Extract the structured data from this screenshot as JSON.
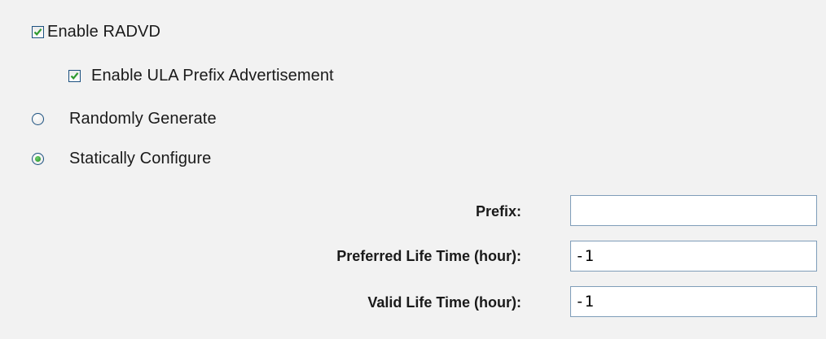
{
  "options": {
    "enable_radvd": {
      "label": "Enable RADVD",
      "checked": true
    },
    "enable_ula": {
      "label": "Enable ULA Prefix Advertisement",
      "checked": true
    },
    "randomly_generate": {
      "label": "Randomly Generate",
      "selected": false
    },
    "statically_configure": {
      "label": "Statically Configure",
      "selected": true
    }
  },
  "fields": {
    "prefix": {
      "label": "Prefix:",
      "value": ""
    },
    "preferred_life_time": {
      "label": "Preferred Life Time (hour):",
      "value": "-1"
    },
    "valid_life_time": {
      "label": "Valid Life Time (hour):",
      "value": "-1"
    }
  },
  "colors": {
    "background": "#f2f2f2",
    "check_green": "#2e9a2e",
    "control_border": "#1c5180",
    "input_border": "#7f9db9"
  },
  "icons": {
    "checkbox_mark": "checkmark-icon",
    "radio_dot": "radio-dot-icon"
  }
}
